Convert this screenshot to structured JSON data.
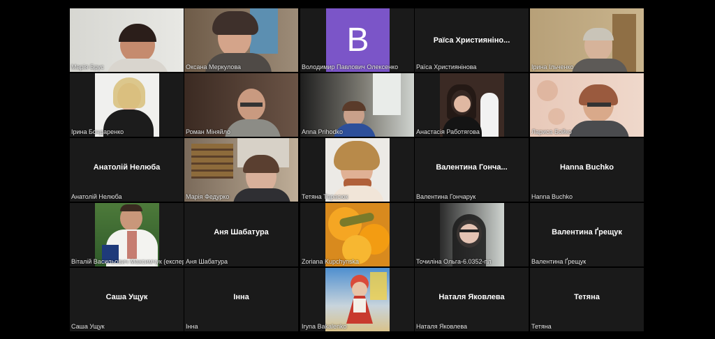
{
  "tiles": [
    {
      "name": "Марія Брус"
    },
    {
      "name": "Оксана Меркулова"
    },
    {
      "name": "Володимир Павлович Олексенко",
      "avatar": "B"
    },
    {
      "name": "Раїса Християнінова",
      "display": "Раїса Християніно..."
    },
    {
      "name": "Ірина Ільченко"
    },
    {
      "name": "Ірина Бондаренко"
    },
    {
      "name": "Роман Міняйло"
    },
    {
      "name": "Anna Prihodko"
    },
    {
      "name": "Анастасія Работягова"
    },
    {
      "name": "Лариса Бойко"
    },
    {
      "name": "Анатолій Нелюба",
      "display": "Анатолій Нелюба"
    },
    {
      "name": "Марія Федурко"
    },
    {
      "name": "Тетяна Тарасюк"
    },
    {
      "name": "Валентина Гончарук",
      "display": "Валентина  Гонча..."
    },
    {
      "name": "Hanna Buchko",
      "display": "Hanna Buchko"
    },
    {
      "name": "Віталій Васильович Максимчук (експерт)"
    },
    {
      "name": "Аня Шабатура",
      "display": "Аня Шабатура"
    },
    {
      "name": "Zoriana Kupchynska"
    },
    {
      "name": "Точиліна Ольга-6.0352-пл"
    },
    {
      "name": "Валентина Ґрещук",
      "display": "Валентина Ґрещук"
    },
    {
      "name": "Саша Ущук",
      "display": "Саша Ущук"
    },
    {
      "name": "Інна",
      "display": "Інна"
    },
    {
      "name": "Iryna Bakalenko"
    },
    {
      "name": "Наталя Яковлева",
      "display": "Наталя Яковлева"
    },
    {
      "name": "Тетяна",
      "display": "Тетяна"
    }
  ],
  "colors": {
    "avatar": "#7b55c8",
    "tile_bg": "#1a1a1a"
  }
}
